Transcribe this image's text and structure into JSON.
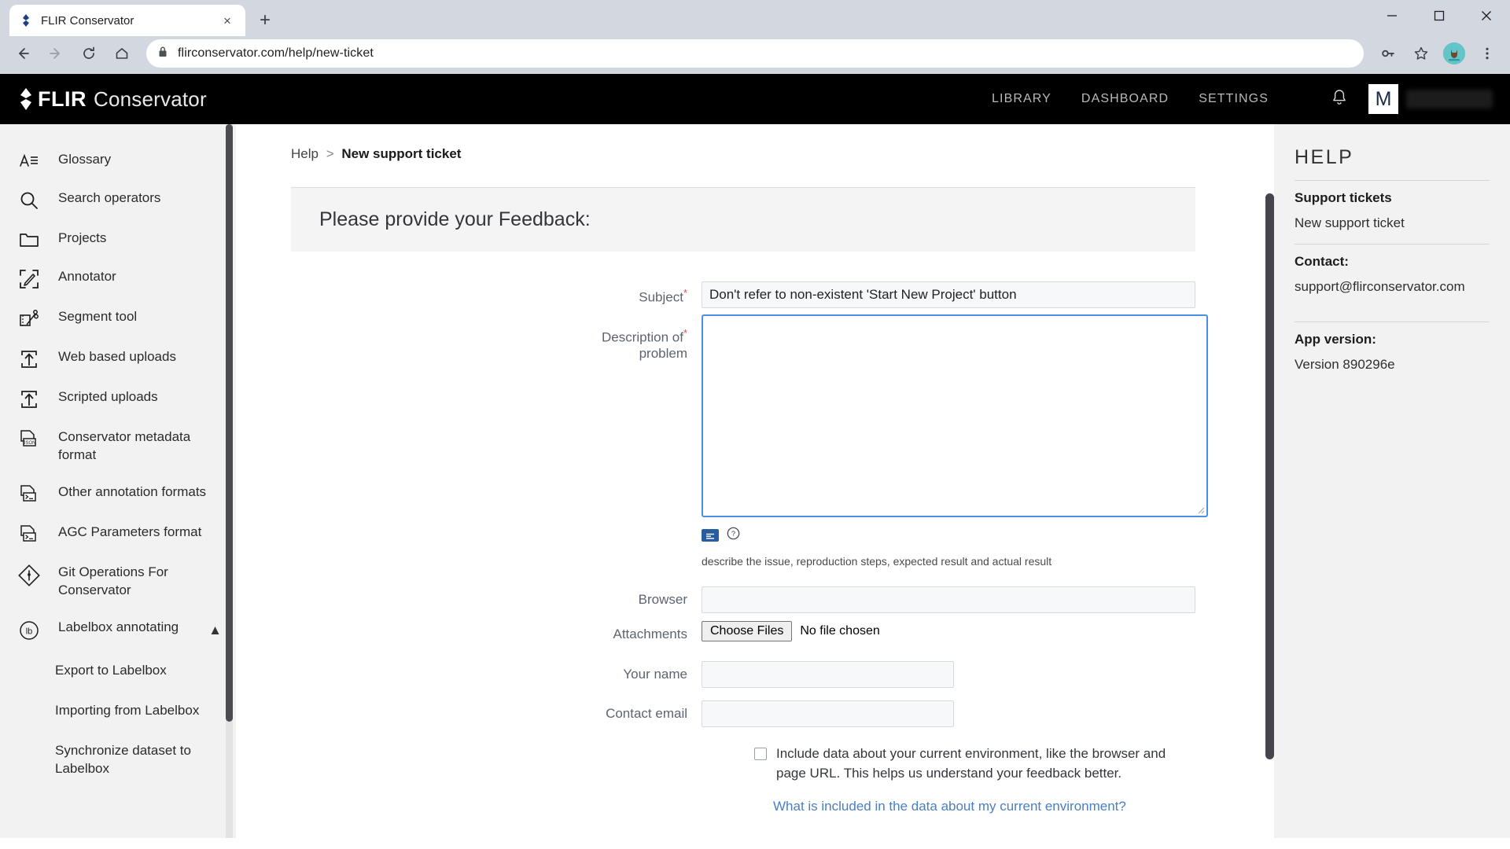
{
  "browser": {
    "tab": {
      "title": "FLIR Conservator",
      "favicon": "flir-diamond-icon",
      "close": "×"
    },
    "new_tab_label": "+",
    "window_controls": {
      "minimize": "—",
      "maximize": "□",
      "close": "✕"
    },
    "nav": {
      "back": "←",
      "forward": "→",
      "reload": "⟳",
      "home": "⌂"
    },
    "omnibox": {
      "url": "flirconservator.com/help/new-ticket",
      "lock_icon": "padlock-icon",
      "key_icon": "key-icon",
      "star_icon": "star-icon",
      "menu_icon": "three-dot-menu-icon",
      "profile_icon": "profile-avatar-icon"
    }
  },
  "app_header": {
    "brand_main": "FLIR",
    "brand_sub": "Conservator",
    "nav_items": [
      {
        "label": "LIBRARY"
      },
      {
        "label": "DASHBOARD"
      },
      {
        "label": "SETTINGS"
      }
    ],
    "bell_icon": "notification-bell-icon",
    "avatar_letter": "M"
  },
  "sidebar": {
    "items": [
      {
        "label": "Glossary",
        "icon": "text-lines-icon"
      },
      {
        "label": "Search operators",
        "icon": "magnifier-icon"
      },
      {
        "label": "Projects",
        "icon": "folder-icon"
      },
      {
        "label": "Annotator",
        "icon": "pencil-crop-icon"
      },
      {
        "label": "Segment tool",
        "icon": "segment-scissors-icon"
      },
      {
        "label": "Web based uploads",
        "icon": "upload-box-icon"
      },
      {
        "label": "Scripted uploads",
        "icon": "upload-box-icon"
      },
      {
        "label": "Conservator metadata format",
        "icon": "json-file-icon"
      },
      {
        "label": "Other annotation formats",
        "icon": "terminal-file-icon"
      },
      {
        "label": "AGC Parameters format",
        "icon": "terminal-file-icon"
      },
      {
        "label": "Git Operations For Conservator",
        "icon": "git-diamond-icon"
      },
      {
        "label": "Labelbox annotating",
        "icon": "labelbox-icon",
        "expanded": true,
        "caret": "▲"
      }
    ],
    "sub_items": [
      {
        "label": "Export to Labelbox"
      },
      {
        "label": "Importing from Labelbox"
      },
      {
        "label": "Synchronize dataset to Labelbox"
      }
    ]
  },
  "main": {
    "breadcrumb": {
      "root": "Help",
      "separator": ">",
      "current": "New support ticket"
    },
    "card_title": "Please provide your Feedback:",
    "fields": {
      "subject": {
        "label": "Subject",
        "required": true,
        "value": "Don't refer to non-existent 'Start New Project' button"
      },
      "description": {
        "label_line1": "Description of",
        "label_line2": "problem",
        "required": true,
        "value": ""
      },
      "browser": {
        "label": "Browser",
        "value": ""
      },
      "attachments": {
        "label": "Attachments",
        "button": "Choose Files",
        "status": "No file chosen"
      },
      "your_name": {
        "label": "Your name",
        "value": ""
      },
      "contact_email": {
        "label": "Contact email",
        "value": ""
      }
    },
    "markdown_icon": "markdown-badge-icon",
    "help_icon": "question-circle-icon",
    "description_hint": "describe the issue, reproduction steps, expected result and actual result",
    "env_checkbox": {
      "checked": false,
      "text": "Include data about your current environment, like the browser and page URL. This helps us understand your feedback better."
    },
    "env_link": "What is included in the data about my current environment?"
  },
  "help_panel": {
    "title": "HELP",
    "support_tickets_heading": "Support tickets",
    "new_ticket_link": "New support ticket",
    "contact_heading": "Contact:",
    "contact_email": "support@flirconservator.com",
    "app_version_heading": "App version:",
    "app_version": "Version 890296e"
  },
  "colors": {
    "accent_blue": "#4a90e2",
    "header_black": "#000000",
    "panel_grey": "#f2f2f2",
    "link_blue": "#4a7fc1",
    "required_red": "#d9534f"
  }
}
